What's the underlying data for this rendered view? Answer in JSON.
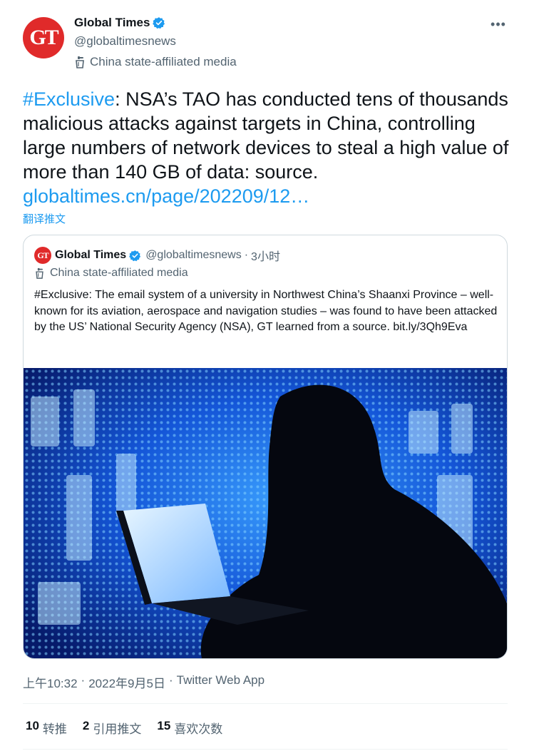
{
  "author": {
    "avatar_text": "GT",
    "display_name": "Global Times",
    "handle": "@globaltimesnews",
    "label": "China state-affiliated media"
  },
  "more_icon": "more-horizontal-icon",
  "tweet": {
    "hashtag": "#Exclusive",
    "text": ": NSA’s TAO has conducted tens of thousands malicious attacks against targets in China, controlling large numbers of network devices to steal a high value of more than 140 GB of data: source.",
    "link": "globaltimes.cn/page/202209/12…",
    "translate": "翻译推文"
  },
  "quote": {
    "avatar_text": "GT",
    "display_name": "Global Times",
    "handle": "@globaltimesnews",
    "dot": "·",
    "time": "3小时",
    "label": "China state-affiliated media",
    "text": "#Exclusive: The email system of a university in Northwest China’s Shaanxi Province – well-known for its aviation, aerospace and navigation studies – was found to have been attacked by the US’ National Security Agency (NSA), GT learned from a source.  bit.ly/3Qh9Eva"
  },
  "meta": {
    "time": "上午10:32",
    "sep1": "·",
    "date": "2022年9月5日",
    "sep2": "·",
    "app": "Twitter Web App"
  },
  "stats": [
    {
      "num": "10",
      "label": "转推"
    },
    {
      "num": "2",
      "label": "引用推文"
    },
    {
      "num": "15",
      "label": "喜欢次数"
    }
  ],
  "colors": {
    "accent": "#1d9bf0",
    "brand_red": "#e02a2a",
    "secondary_text": "#536471"
  }
}
